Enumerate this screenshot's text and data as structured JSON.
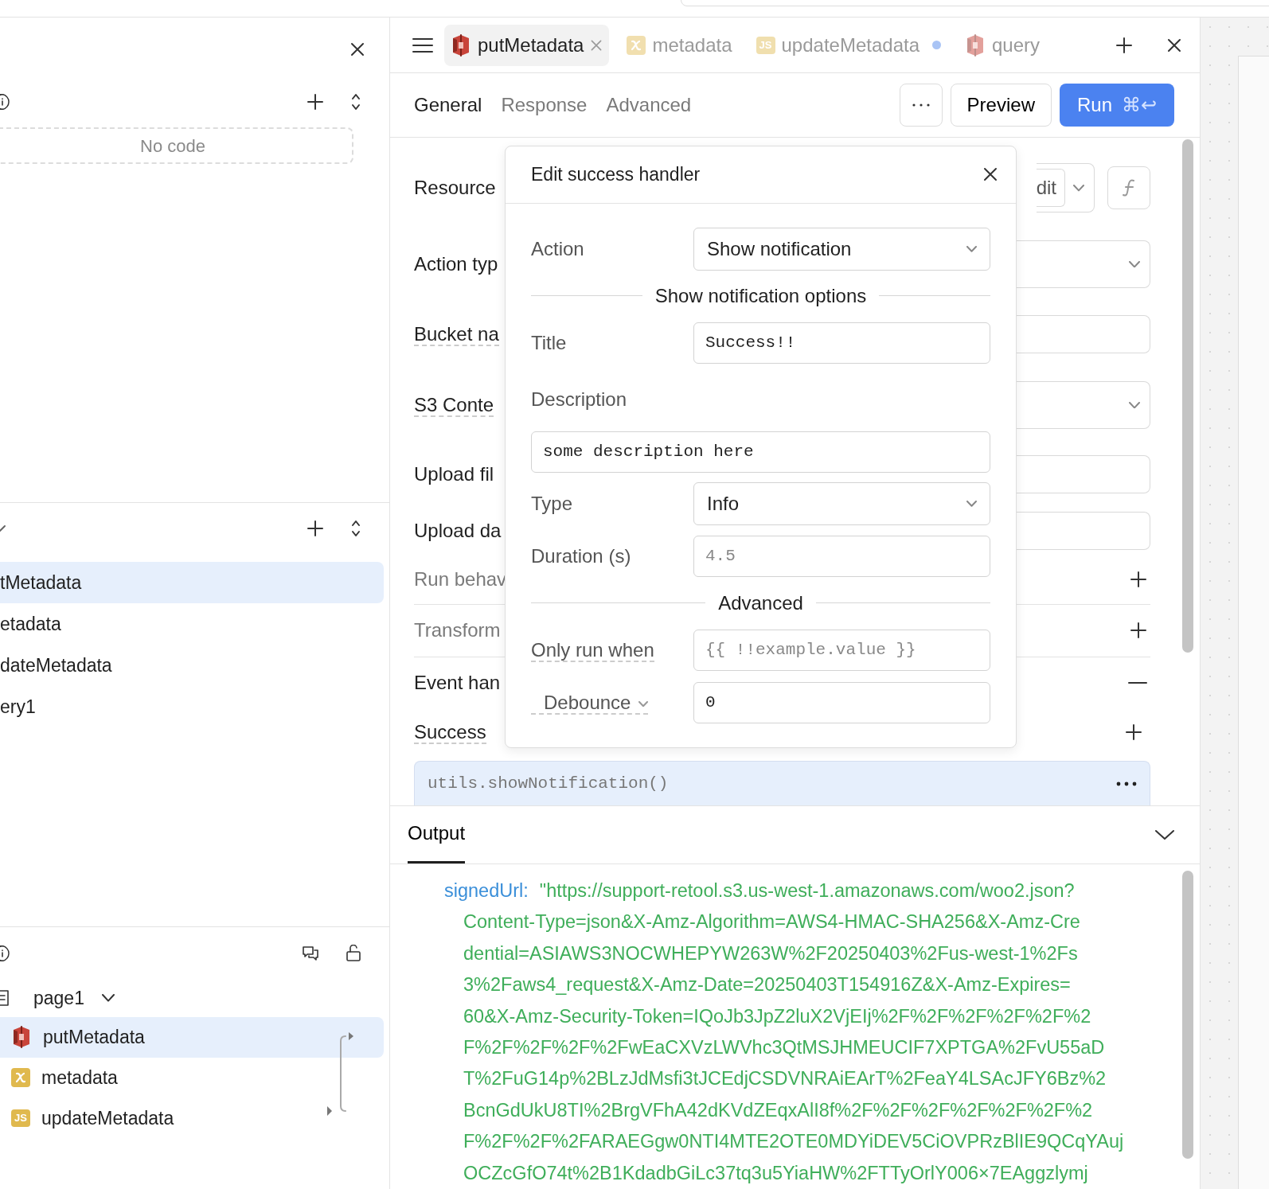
{
  "left_panel": {
    "code_section": {
      "empty_text": "No code"
    },
    "list_section": {
      "items": [
        {
          "label": "tMetadata",
          "selected": true
        },
        {
          "label": "etadata",
          "selected": false
        },
        {
          "label": "dateMetadata",
          "selected": false
        },
        {
          "label": "ery1",
          "selected": false
        }
      ]
    },
    "tree_section": {
      "page": "page1",
      "items": [
        {
          "label": "putMetadata",
          "kind": "s3",
          "selected": true
        },
        {
          "label": "metadata",
          "kind": "variable",
          "selected": false
        },
        {
          "label": "updateMetadata",
          "kind": "js",
          "icon_text": "JS",
          "selected": false
        }
      ]
    }
  },
  "editor": {
    "tabs": [
      {
        "label": "putMetadata",
        "kind": "s3",
        "selected": true,
        "modified": false
      },
      {
        "label": "metadata",
        "kind": "variable",
        "selected": false,
        "modified": false
      },
      {
        "label": "updateMetadata",
        "kind": "js",
        "icon_text": "JS",
        "selected": false,
        "modified": true
      },
      {
        "label": "query",
        "kind": "s3",
        "selected": false,
        "modified": false
      }
    ],
    "subtabs": [
      {
        "label": "General",
        "selected": true
      },
      {
        "label": "Response",
        "selected": false
      },
      {
        "label": "Advanced",
        "selected": false
      }
    ],
    "preview_button": "Preview",
    "run_button": "Run",
    "run_shortcut": "⌘↩",
    "form_rows": [
      {
        "label": "Resource",
        "kind": "resource",
        "underlined": false,
        "control_text": "dit"
      },
      {
        "label": "Action typ",
        "kind": "select",
        "underlined": false
      },
      {
        "label": "Bucket na",
        "kind": "input",
        "underlined": true
      },
      {
        "label": "S3 Conte",
        "kind": "select",
        "underlined": true
      },
      {
        "label": "Upload fil",
        "kind": "input",
        "underlined": false
      },
      {
        "label": "Upload da",
        "kind": "input",
        "underlined": false
      },
      {
        "label": "Run behav",
        "kind": "section",
        "underlined": false,
        "expanded": false
      },
      {
        "label": "Transform",
        "kind": "section",
        "underlined": false,
        "expanded": false
      },
      {
        "label": "Event han",
        "kind": "section",
        "underlined": false,
        "expanded": true
      },
      {
        "label": "Success",
        "kind": "add",
        "underlined": true
      }
    ],
    "handlers": [
      {
        "code": "utils.showNotification()"
      }
    ],
    "popup": {
      "title": "Edit success handler",
      "fields": [
        {
          "kind": "select",
          "label": "Action",
          "value": "Show notification"
        },
        {
          "kind": "divider",
          "label": "Show notification options"
        },
        {
          "kind": "input",
          "label": "Title",
          "value": "Success!!"
        },
        {
          "kind": "wide",
          "label": "Description",
          "value": "some description here"
        },
        {
          "kind": "select",
          "label": "Type",
          "value": "Info"
        },
        {
          "kind": "input",
          "label": "Duration (s)",
          "placeholder": "4.5"
        },
        {
          "kind": "divider",
          "label": "Advanced"
        },
        {
          "kind": "input",
          "label": "Only run when",
          "underlined": true,
          "placeholder": "{{ !!example.value }}"
        },
        {
          "kind": "dropdown-input",
          "label": "Debounce",
          "underlined": true,
          "value": "0"
        }
      ]
    },
    "output": {
      "tab": "Output",
      "key": "signedUrl:",
      "value_lines": [
        "\"https://support-retool.s3.us-west-1.amazonaws.com/woo2.json?",
        "Content-Type=json&X-Amz-Algorithm=AWS4-HMAC-SHA256&X-Amz-Cre",
        "dential=ASIAWS3NOCWHEPYW263W%2F20250403%2Fus-west-1%2Fs",
        "3%2Faws4_request&X-Amz-Date=20250403T154916Z&X-Amz-Expires=",
        "60&X-Amz-Security-Token=IQoJb3JpZ2luX2VjEIj%2F%2F%2F%2F%2F%2",
        "F%2F%2F%2F%2FwEaCXVzLWVhc3QtMSJHMEUCIF7XPTGA%2FvU55aD",
        "T%2FuG14p%2BLzJdMsfi3tJCEdjCSDVNRAiEArT%2FeaY4LSAcJFY6Bz%2",
        "BcnGdUkU8TI%2BrgVFhA42dKVdZEqxAlI8f%2F%2F%2F%2F%2F%2F%2",
        "F%2F%2F%2FARAEGgw0NTI4MTE2OTE0MDYiDEV5CiOVPRzBlIE9QCqYAuj",
        "OCZcGfO74t%2B1KdadbGiLc37tq3u5YiaHW%2FTTyOrlY006×7EAggzlymj"
      ]
    }
  }
}
